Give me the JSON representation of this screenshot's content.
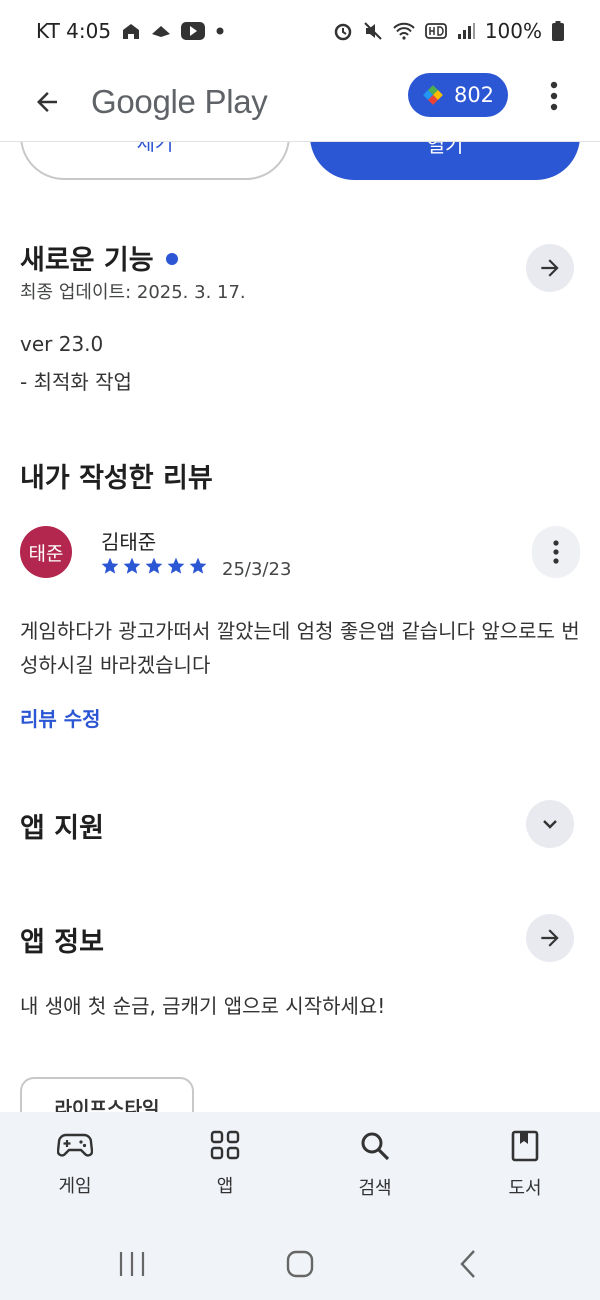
{
  "status_bar": {
    "carrier_time": "KT 4:05",
    "battery": "100%"
  },
  "app_bar": {
    "title": "Google Play",
    "points": "802"
  },
  "actions": {
    "remove_label": "제거",
    "open_label": "열기"
  },
  "whats_new": {
    "title": "새로운 기능",
    "updated": "최종 업데이트: 2025. 3. 17.",
    "version": "ver 23.0",
    "note": "- 최적화 작업"
  },
  "my_review": {
    "title": "내가 작성한 리뷰",
    "avatar_text": "태준",
    "reviewer_name": "김태준",
    "rating": 5,
    "date": "25/3/23",
    "text": "게임하다가 광고가떠서 깔았는데 엄청 좋은앱 같습니다 앞으로도 번성하시길 바라겠습니다",
    "edit_label": "리뷰 수정"
  },
  "app_support": {
    "title": "앱 지원"
  },
  "app_info": {
    "title": "앱 정보",
    "description": "내 생애 첫 순금, 금캐기 앱으로 시작하세요!",
    "chip": "라이프스타일"
  },
  "bottom_nav": [
    {
      "label": "게임",
      "icon": "gamepad-icon"
    },
    {
      "label": "앱",
      "icon": "apps-grid-icon"
    },
    {
      "label": "검색",
      "icon": "search-icon"
    },
    {
      "label": "도서",
      "icon": "book-icon"
    }
  ],
  "colors": {
    "accent": "#2b56d4",
    "avatar": "#b3264d",
    "nav_bg": "#f0f3f8"
  }
}
